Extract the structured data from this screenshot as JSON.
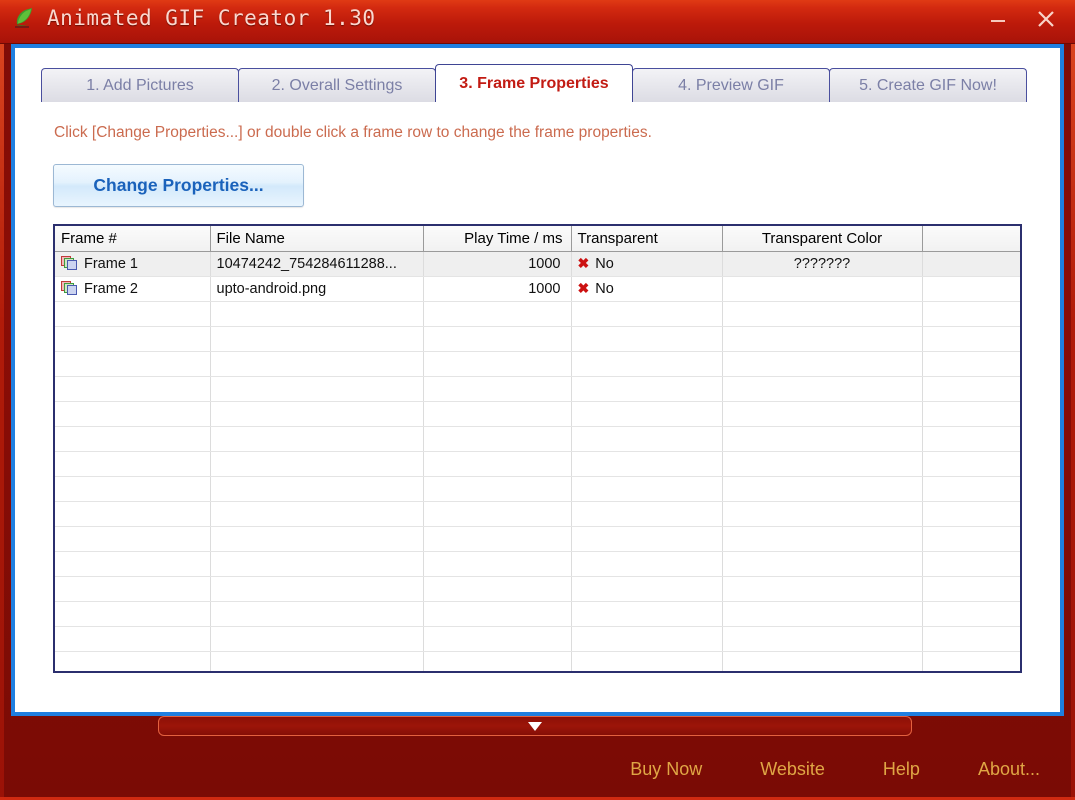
{
  "window": {
    "title": "Animated GIF Creator 1.30",
    "icon": "app-crescent-icon",
    "minimize_label": "–",
    "close_label": "✕"
  },
  "tabs": [
    {
      "label": "1. Add Pictures",
      "active": false
    },
    {
      "label": "2. Overall Settings",
      "active": false
    },
    {
      "label": "3. Frame Properties",
      "active": true
    },
    {
      "label": "4. Preview GIF",
      "active": false
    },
    {
      "label": "5. Create GIF Now!",
      "active": false
    }
  ],
  "panel": {
    "hint": "Click [Change Properties...] or double click a frame row to change the frame properties.",
    "change_properties_label": "Change Properties..."
  },
  "table": {
    "columns": [
      {
        "key": "frame",
        "label": "Frame #",
        "align": "left"
      },
      {
        "key": "file",
        "label": "File Name",
        "align": "left"
      },
      {
        "key": "playtime",
        "label": "Play Time / ms",
        "align": "right"
      },
      {
        "key": "transparent",
        "label": "Transparent",
        "align": "left"
      },
      {
        "key": "transparent_color",
        "label": "Transparent Color",
        "align": "center"
      },
      {
        "key": "spare",
        "label": "",
        "align": "left"
      }
    ],
    "rows": [
      {
        "frame": "Frame 1",
        "file": "10474242_754284611288...",
        "playtime": "1000",
        "transparent": "No",
        "transparent_color": "???????",
        "spare": "",
        "selected": true
      },
      {
        "frame": "Frame 2",
        "file": "upto-android.png",
        "playtime": "1000",
        "transparent": "No",
        "transparent_color": "",
        "spare": "",
        "selected": false
      }
    ],
    "empty_row_count": 16,
    "transparent_false_mark": "✖"
  },
  "collapse": {
    "icon": "chevron-down-icon"
  },
  "footer": {
    "links": [
      {
        "label": "Buy Now"
      },
      {
        "label": "Website"
      },
      {
        "label": "Help"
      },
      {
        "label": "About..."
      }
    ]
  },
  "colors": {
    "titlebar_red": "#bc1a0a",
    "body_red": "#8b0d06",
    "client_border_blue": "#1f7fe0",
    "active_tab_text": "#c21b13",
    "inactive_tab_text": "#7b7fa6",
    "hint_text": "#cb6b4f",
    "button_text_blue": "#1a62bb",
    "footer_link_gold": "#e0a645",
    "grid_border": "#2b2f6e",
    "selected_row_bg": "#efefef",
    "x_mark_red": "#cc1111"
  }
}
